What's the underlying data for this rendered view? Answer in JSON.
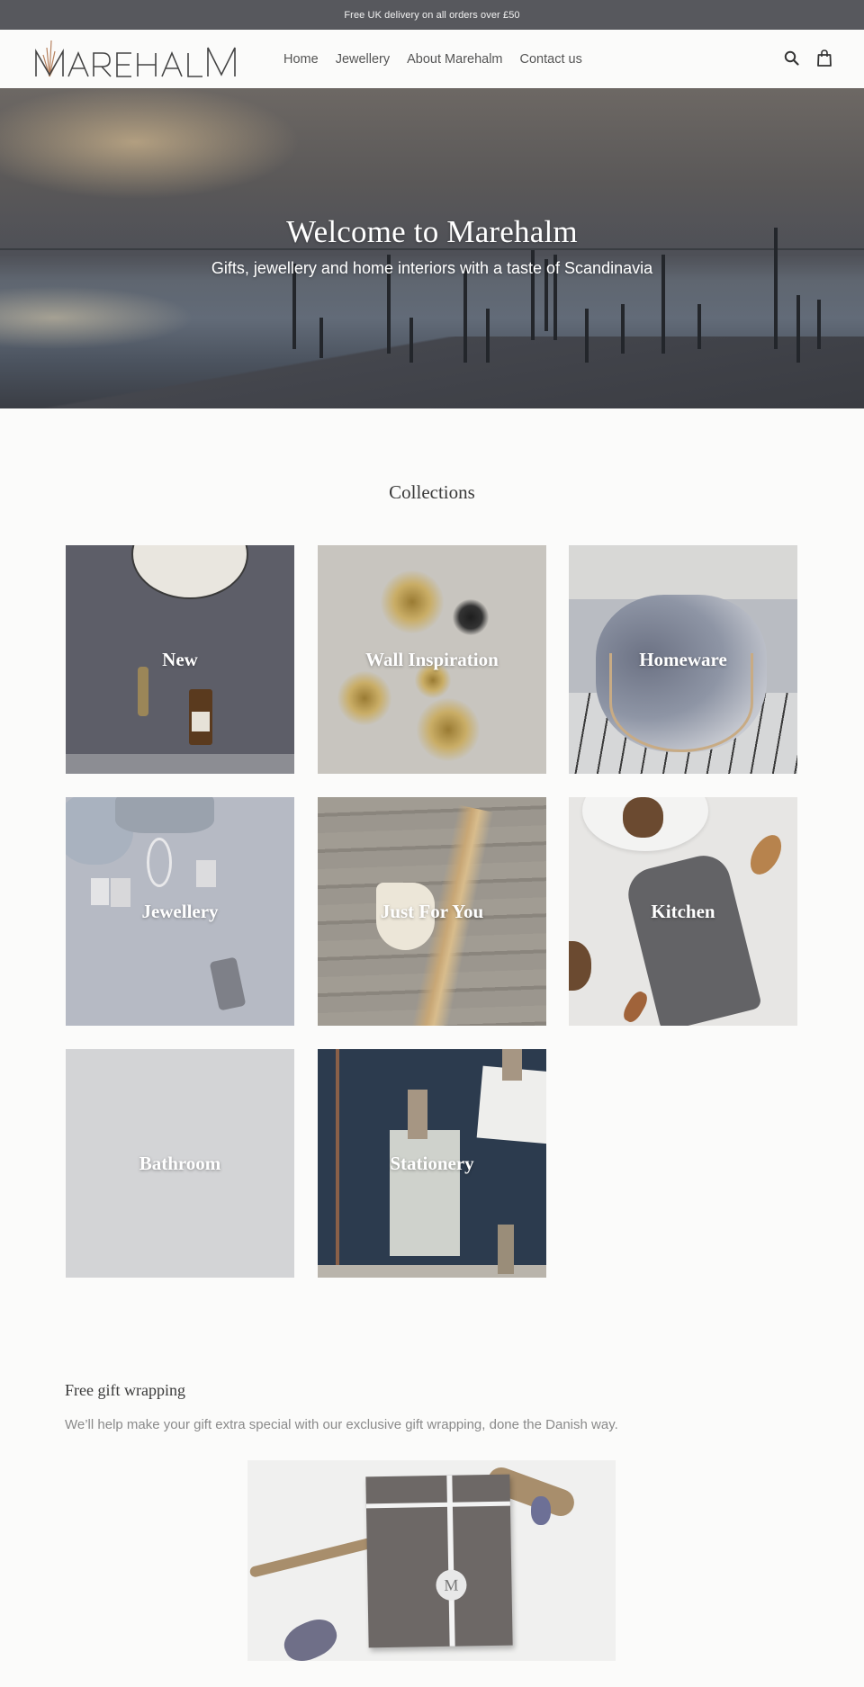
{
  "announcement": {
    "text": "Free UK delivery on all orders over £50"
  },
  "header": {
    "logo_text": "MAREHALM",
    "nav": [
      {
        "label": "Home"
      },
      {
        "label": "Jewellery"
      },
      {
        "label": "About Marehalm"
      },
      {
        "label": "Contact us"
      }
    ],
    "icons": {
      "search": "search-icon",
      "cart": "shopping-bag-icon"
    }
  },
  "hero": {
    "title": "Welcome to Marehalm",
    "subtitle": "Gifts, jewellery and home interiors with a taste of Scandinavia"
  },
  "collections": {
    "title": "Collections",
    "items": [
      {
        "label": "New"
      },
      {
        "label": "Wall Inspiration"
      },
      {
        "label": "Homeware"
      },
      {
        "label": "Jewellery"
      },
      {
        "label": "Just For You"
      },
      {
        "label": "Kitchen"
      },
      {
        "label": "Bathroom"
      },
      {
        "label": "Stationery"
      }
    ]
  },
  "gift": {
    "title": "Free gift wrapping",
    "text": "We’ll help make your gift extra special with our exclusive gift wrapping, done the Danish way."
  },
  "colors": {
    "announcement_bg": "#57585d",
    "page_bg": "#fbfbfa",
    "text": "#3a3a3a",
    "muted_text": "#8a8a8a",
    "logo_accent": "#b7825f"
  }
}
